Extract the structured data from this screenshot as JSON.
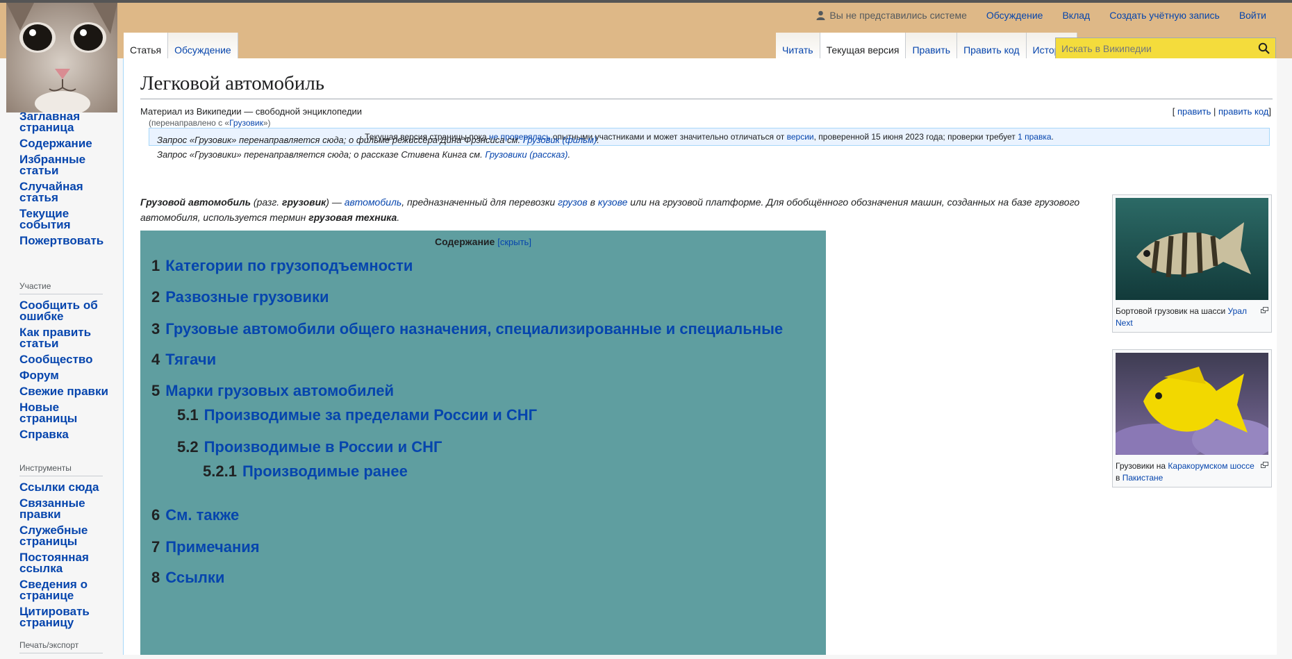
{
  "personal": {
    "anon": "Вы не представились системе",
    "talk": "Обсуждение",
    "contrib": "Вклад",
    "create": "Создать учётную запись",
    "login": "Войти"
  },
  "left_tabs": [
    "Статья",
    "Обсуждение"
  ],
  "right_tabs": [
    "Читать",
    "Текущая версия",
    "Править",
    "Править код",
    "История"
  ],
  "search": {
    "placeholder": "Искать в Википедии"
  },
  "sidebar": {
    "main": [
      "Заглавная страница",
      "Содержание",
      "Избранные статьи",
      "Случайная статья",
      "Текущие события",
      "Пожертвовать"
    ],
    "participation_header": "Участие",
    "participation": [
      "Сообщить об ошибке",
      "Как править статьи",
      "Сообщество",
      "Форум",
      "Свежие правки",
      "Новые страницы",
      "Справка"
    ],
    "tools_header": "Инструменты",
    "tools": [
      "Ссылки сюда",
      "Связанные правки",
      "Служебные страницы",
      "Постоянная ссылка",
      "Сведения о странице",
      "Цитировать страницу"
    ],
    "print_header": "Печать/экспорт"
  },
  "article": {
    "title": "Легковой автомобиль",
    "tagline": "Материал из Википедии — свободной энциклопедии",
    "edit_open": "[",
    "edit": "править",
    "edit_sep": "|",
    "edit_code": "править код",
    "edit_close": "]",
    "redirect_pre": "(перенаправлено с «",
    "redirect_link": "Грузовик",
    "redirect_post": "»)",
    "flag_pre": "Текущая версия страницы пока ",
    "flag_link1": "не проверялась",
    "flag_mid": " опытными участниками и может значительно отличаться от ",
    "flag_link2": "версии",
    "flag_mid2": ", проверенной 15 июня 2023 года; проверки требует ",
    "flag_link3": "1 правка",
    "flag_end": ".",
    "hat1_pre": "Запрос «Грузовик» перенаправляется сюда; о фильме режиссёра Дина Фрэнсиса см. ",
    "hat1_link": "Грузовик (фильм)",
    "hat1_end": ".",
    "hat2_pre": "Запрос «Грузовики» перенаправляется сюда; о рассказе Стивена Кинга см. ",
    "hat2_link": "Грузовики (рассказ)",
    "hat2_end": ".",
    "lead_b1": "Грузовой автомобиль",
    "lead_t1": " (разг. ",
    "lead_b2": "грузовик",
    "lead_t2": ") — ",
    "lead_l1": "автомобиль",
    "lead_t3": ", предназначенный для перевозки ",
    "lead_l2": "грузов",
    "lead_t4": " в ",
    "lead_l3": "кузове",
    "lead_t5": " или на грузовой платформе. Для обобщённого обозначения машин, созданных на базе грузового автомобиля, используется термин ",
    "lead_b3": "грузовая техника",
    "lead_t6": "."
  },
  "toc": {
    "title": "Содержание",
    "hide_open": "[",
    "hide": "скрыть",
    "hide_close": "]",
    "items": [
      {
        "num": "1",
        "text": "Категории по грузоподъемности"
      },
      {
        "num": "2",
        "text": "Развозные грузовики"
      },
      {
        "num": "3",
        "text": "Грузовые автомобили общего назначения, специализированные и специальные"
      },
      {
        "num": "4",
        "text": "Тягачи"
      },
      {
        "num": "5",
        "text": "Марки грузовых автомобилей"
      },
      {
        "num": "5.1",
        "text": "Производимые за пределами России и СНГ"
      },
      {
        "num": "5.2",
        "text": "Производимые в России и СНГ"
      },
      {
        "num": "5.2.1",
        "text": "Производимые ранее"
      },
      {
        "num": "6",
        "text": "См. также"
      },
      {
        "num": "7",
        "text": "Примечания"
      },
      {
        "num": "8",
        "text": "Ссылки"
      }
    ]
  },
  "thumbs": [
    {
      "cap_pre": "Бортовой грузовик на шасси ",
      "cap_link": "Урал Next",
      "cap_link2": "",
      "cap_mid": "",
      "cap_link3": ""
    },
    {
      "cap_pre": "Грузовики на ",
      "cap_link": "Каракорумском шоссе",
      "cap_mid": " в ",
      "cap_link3": "Пакистане"
    }
  ],
  "colors": {
    "topbar": "#deb887",
    "toc_bg": "#5f9ea0",
    "search_bg": "#f4dc3c",
    "link": "#0645ad"
  }
}
